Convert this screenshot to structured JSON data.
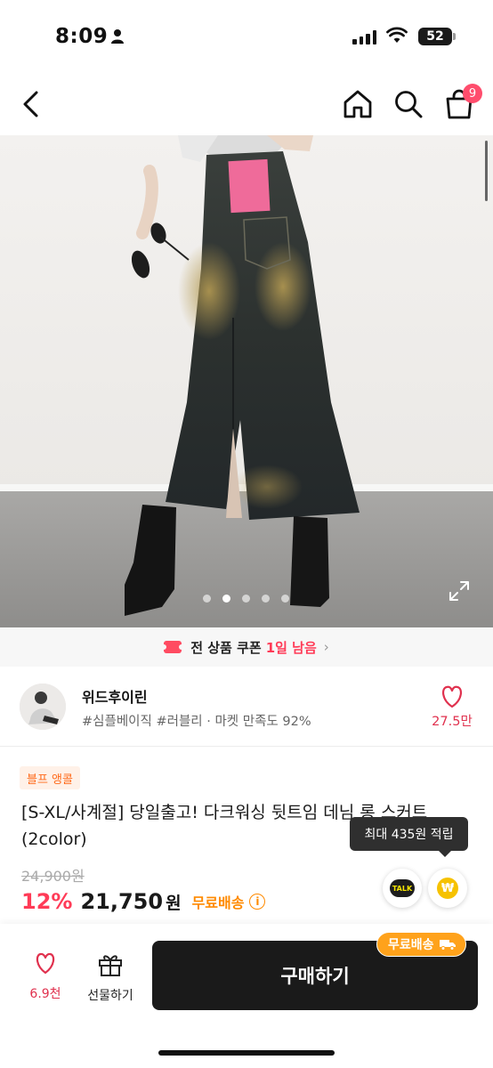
{
  "status_bar": {
    "time": "8:09",
    "battery": "52"
  },
  "nav": {
    "cart_count": "9"
  },
  "gallery": {
    "pages": 5,
    "active_index": 1
  },
  "coupon": {
    "bold_text": "전 상품 쿠폰",
    "highlight": "1일 남음"
  },
  "shop": {
    "name": "위드후이린",
    "tags": "#심플베이직 #러블리 · 마켓 만족도 92%",
    "like_count": "27.5만"
  },
  "product": {
    "badge": "블프 앵콜",
    "title": "[S-XL/사계절] 당일출고! 다크워싱 뒷트임 데님 롱 스커트 (2color)",
    "original_price": "24,900원",
    "discount": "12%",
    "price": "21,750",
    "currency": "원",
    "shipping": "무료배송",
    "info_icon": "i"
  },
  "tooltip": {
    "text": "최대 435원 적립"
  },
  "talk": {
    "label": "TALK"
  },
  "point": {
    "symbol": "₩"
  },
  "bottom": {
    "wish_count": "6.9천",
    "gift_label": "선물하기",
    "buy_label": "구매하기",
    "free_chip": "무료배송"
  }
}
